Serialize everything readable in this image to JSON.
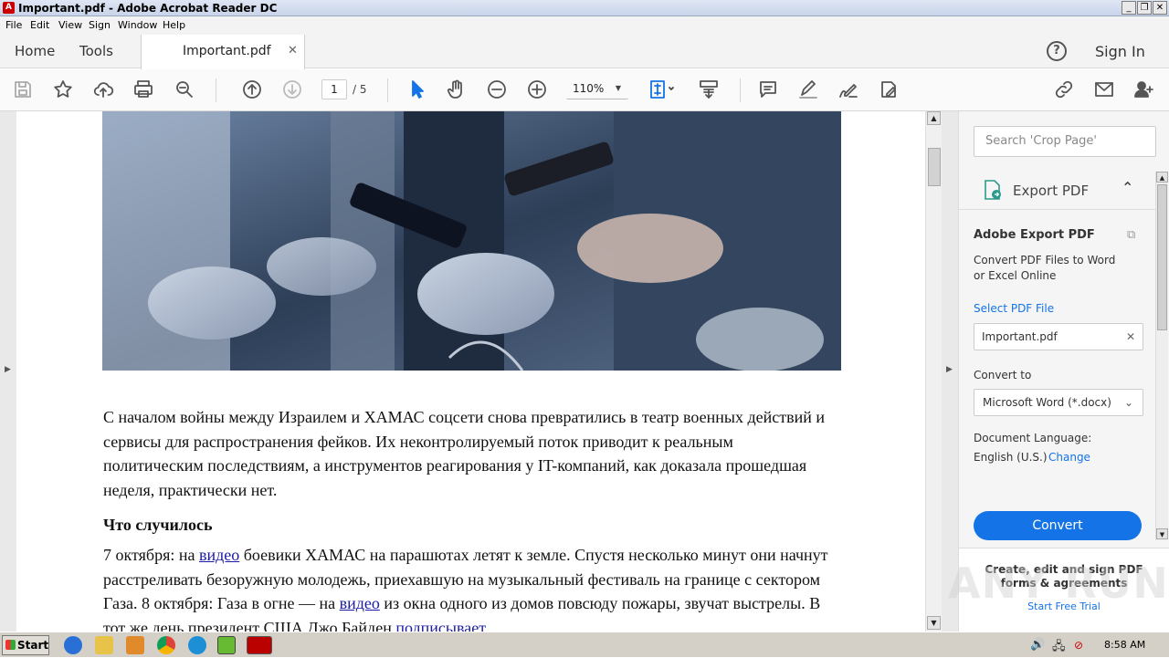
{
  "window": {
    "title": "Important.pdf - Adobe Acrobat Reader DC"
  },
  "menu": [
    "File",
    "Edit",
    "View",
    "Sign",
    "Window",
    "Help"
  ],
  "tabs": {
    "home": "Home",
    "tools": "Tools",
    "doc": "Important.pdf",
    "sign_in": "Sign In"
  },
  "toolbar": {
    "page_current": "1",
    "page_total": "/ 5",
    "zoom": "110%"
  },
  "icons": [
    "save-icon",
    "star-icon",
    "upload-icon",
    "print-icon",
    "zoom-search-icon",
    "page-up-icon",
    "page-down-icon",
    "select-arrow-icon",
    "hand-icon",
    "zoom-out-icon",
    "zoom-in-icon",
    "fit-page-icon",
    "scroll-mode-icon",
    "comment-icon",
    "highlight-icon",
    "sign-icon",
    "edit-icon",
    "link-icon",
    "mail-icon",
    "add-user-icon"
  ],
  "article": {
    "p1": "С началом войны между Израилем и ХАМАС соцсети снова превратились в театр военных действий и сервисы для распространения фейков. Их неконтролируемый поток приводит к реальным политическим последствиям, а инструментов реагирования у IT-компаний, как доказала прошедшая неделя, практически нет.",
    "h1": "Что случилось",
    "p2a": "7 октября: на ",
    "link1": "видео",
    "p2b": " боевики ХАМАС на парашютах летят к земле. Спустя несколько минут они начнут расстреливать безоружную молодежь, приехавшую на музыкальный фестиваль на границе с сектором Газа. 8 октября: Газа в огне — на ",
    "link2": "видео",
    "p2c": " из окна одного из домов повсюду пожары, звучат выстрелы. В тот же день президент США Джо Байден ",
    "link3": "подписывает"
  },
  "panel": {
    "search_placeholder": "Search 'Crop Page'",
    "export_title": "Export PDF",
    "adobe_export": "Adobe Export PDF",
    "desc_line1": "Convert PDF Files to Word",
    "desc_line2": "or Excel Online",
    "select_file": "Select PDF File",
    "file_name": "Important.pdf",
    "convert_to": "Convert to",
    "format": "Microsoft Word (*.docx)",
    "doc_lang_label": "Document Language:",
    "doc_lang": "English (U.S.)",
    "change": "Change",
    "convert_btn": "Convert",
    "promo_line1": "Create, edit and sign PDF",
    "promo_line2": "forms & agreements",
    "trial": "Start Free Trial"
  },
  "taskbar": {
    "start": "Start",
    "clock": "8:58 AM"
  },
  "watermark": "ANY RUN"
}
